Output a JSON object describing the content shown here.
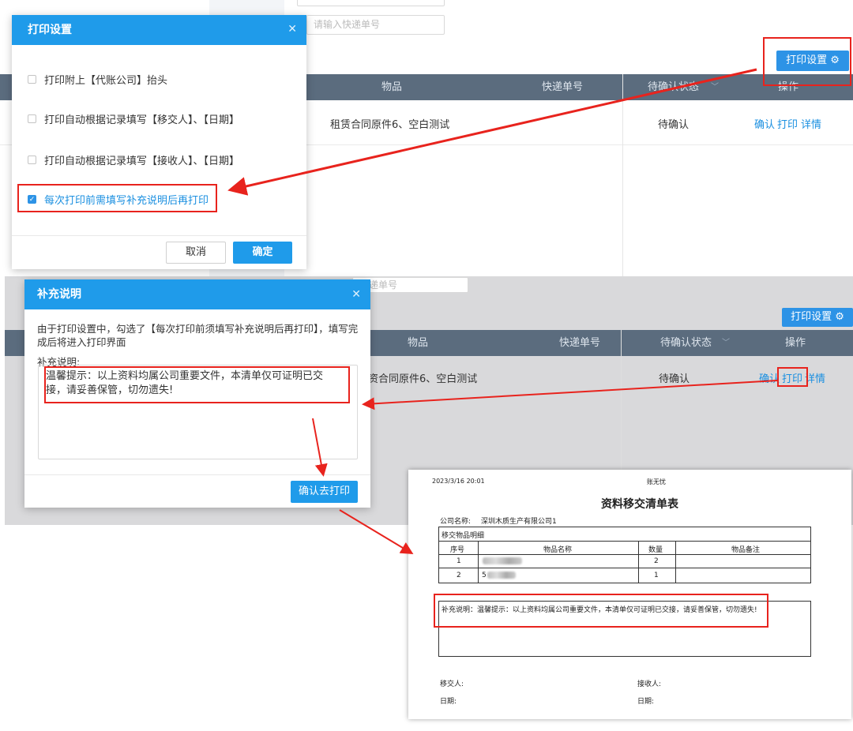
{
  "bg_top": {
    "express_placeholder": "请输入快递单号",
    "print_settings_button": "打印设置",
    "columns": [
      "物品",
      "快递单号",
      "待确认状态",
      "操作"
    ],
    "row": {
      "item": "租赁合同原件6、空白测试",
      "status": "待确认",
      "actions": [
        "确认",
        "打印",
        "详情"
      ]
    }
  },
  "bg_bottom": {
    "express_placeholder": "快递单号",
    "print_settings_button": "打印设置",
    "columns": [
      "物品",
      "快递单号",
      "待确认状态",
      "操作"
    ],
    "row": {
      "item": "资合同原件6、空白测试",
      "status": "待确认",
      "actions": [
        "确认",
        "打印",
        "详情"
      ]
    }
  },
  "print_settings_dialog": {
    "title": "打印设置",
    "options": [
      {
        "label": "打印附上【代账公司】抬头",
        "checked": false
      },
      {
        "label": "打印自动根据记录填写【移交人】、【日期】",
        "checked": false
      },
      {
        "label": "打印自动根据记录填写【接收人】、【日期】",
        "checked": false
      },
      {
        "label": "每次打印前需填写补充说明后再打印",
        "checked": true
      }
    ],
    "cancel": "取消",
    "ok": "确定"
  },
  "supplement_dialog": {
    "title": "补充说明",
    "description": "由于打印设置中，勾选了【每次打印前须填写补充说明后再打印】，填写完成后将进入打印界面",
    "field_label": "补充说明:",
    "field_value": "温馨提示：以上资料均属公司重要文件，本清单仅可证明已交接，请妥善保管，切勿遗失!",
    "confirm": "确认去打印"
  },
  "print_preview": {
    "datetime": "2023/3/16 20:01",
    "brand": "账无忧",
    "title": "资料移交清单表",
    "company_label": "公司名称:",
    "company_name": "深圳木质生产有限公司1",
    "section": "移交物品明细",
    "headers": [
      "序号",
      "物品名称",
      "数量",
      "物品备注"
    ],
    "rows": [
      {
        "no": "1",
        "qty": "2"
      },
      {
        "no": "2",
        "name_fragment": "5",
        "qty": "1"
      }
    ],
    "supplement": "补充说明：温馨提示：以上资料均属公司重要文件，本清单仅可证明已交接，请妥善保管，切勿遗失!",
    "handover_label": "移交人:",
    "receiver_label": "接收人:",
    "date_label": "日期:",
    "date_label_2": "日期:"
  },
  "colors": {
    "accent": "#1f9bea",
    "annotation_red": "#e8231d",
    "table_header": "#5b6c7e"
  }
}
